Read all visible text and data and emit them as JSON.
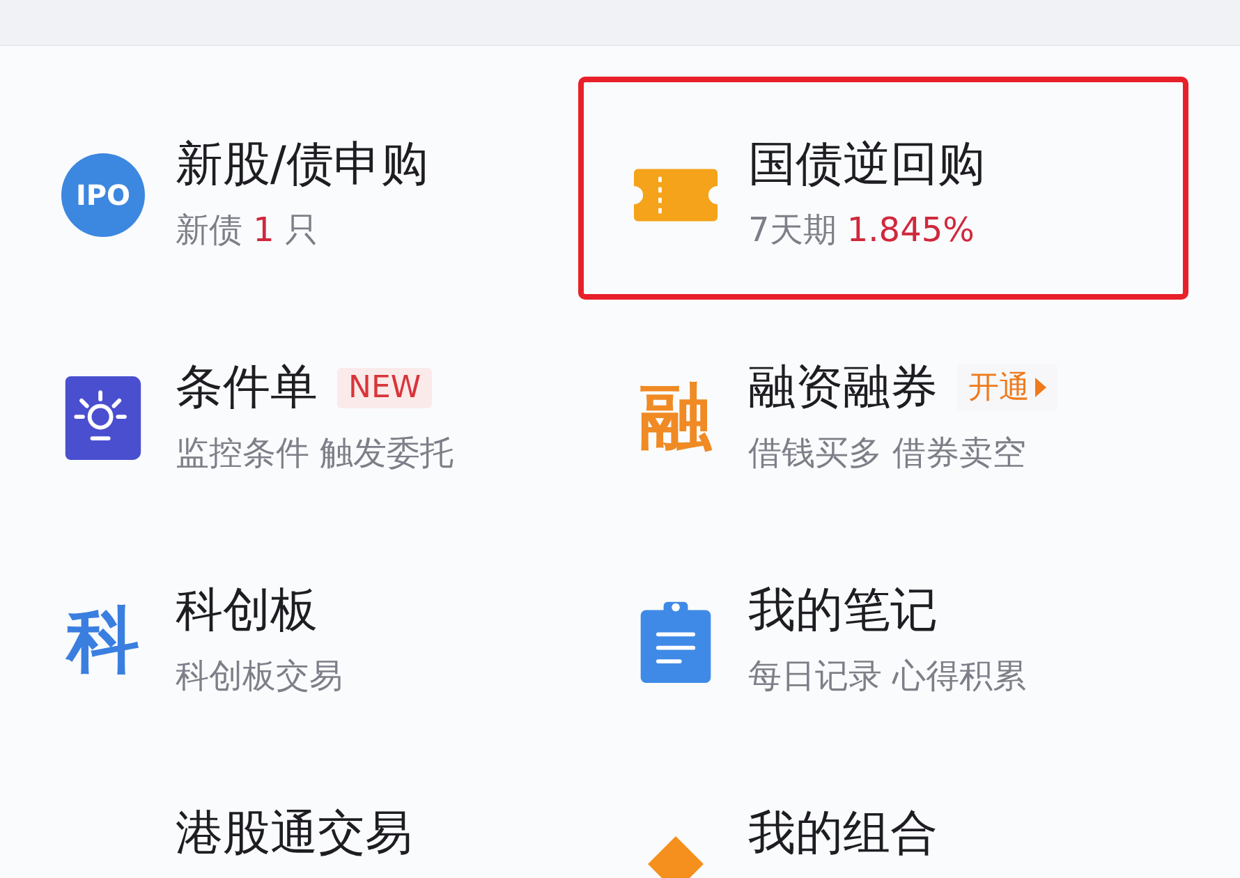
{
  "items": [
    {
      "icon": {
        "kind": "ipo",
        "text": "IPO"
      },
      "title": "新股/债申购",
      "highlighted": false,
      "subtitle": [
        {
          "text": "新债",
          "kind": "plain"
        },
        {
          "text": "1",
          "kind": "accent"
        },
        {
          "text": "只",
          "kind": "plain"
        }
      ]
    },
    {
      "icon": {
        "kind": "ticket"
      },
      "title": "国债逆回购",
      "highlighted": true,
      "subtitle": [
        {
          "text": "7天期",
          "kind": "plain"
        },
        {
          "text": "1.845%",
          "kind": "accent"
        }
      ]
    },
    {
      "icon": {
        "kind": "bulb"
      },
      "title": "条件单",
      "highlighted": false,
      "badge": {
        "text": "NEW",
        "kind": "new"
      },
      "subtitle": [
        {
          "text": "监控条件 触发委托",
          "kind": "plain"
        }
      ]
    },
    {
      "icon": {
        "kind": "glyph",
        "text": "融",
        "color": "#f08a24"
      },
      "title": "融资融券",
      "highlighted": false,
      "badge": {
        "text": "开通",
        "kind": "open"
      },
      "subtitle": [
        {
          "text": "借钱买多 借券卖空",
          "kind": "plain"
        }
      ]
    },
    {
      "icon": {
        "kind": "glyph",
        "text": "科",
        "color": "#3a7fe0"
      },
      "title": "科创板",
      "highlighted": false,
      "subtitle": [
        {
          "text": "科创板交易",
          "kind": "plain"
        }
      ]
    },
    {
      "icon": {
        "kind": "clipboard"
      },
      "title": "我的笔记",
      "highlighted": false,
      "subtitle": [
        {
          "text": "每日记录 心得积累",
          "kind": "plain"
        }
      ]
    },
    {
      "icon": {
        "kind": "none"
      },
      "title": "港股通交易",
      "highlighted": false
    },
    {
      "icon": {
        "kind": "diamond"
      },
      "title": "我的组合",
      "highlighted": false
    }
  ]
}
